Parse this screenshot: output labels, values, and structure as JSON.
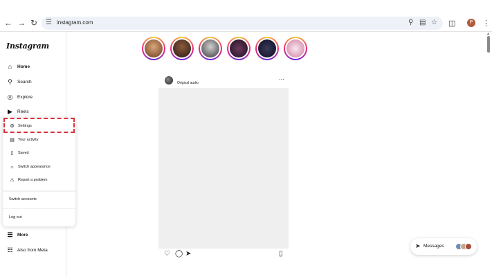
{
  "browser": {
    "url": "instagram.com",
    "profile_initial": "P"
  },
  "sidebar": {
    "logo": "Instagram",
    "nav": [
      {
        "label": "Home",
        "icon": "home-icon"
      },
      {
        "label": "Search",
        "icon": "search-icon"
      },
      {
        "label": "Explore",
        "icon": "compass-icon"
      },
      {
        "label": "Reels",
        "icon": "reels-icon"
      }
    ],
    "bottom": [
      {
        "label": "More",
        "icon": "menu-icon"
      },
      {
        "label": "Also from Meta",
        "icon": "meta-icon"
      }
    ]
  },
  "menu": {
    "items": [
      {
        "label": "Settings",
        "icon": "gear-icon"
      },
      {
        "label": "Your activity",
        "icon": "activity-icon"
      },
      {
        "label": "Saved",
        "icon": "bookmark-icon"
      },
      {
        "label": "Switch appearance",
        "icon": "sun-icon"
      },
      {
        "label": "Report a problem",
        "icon": "report-icon"
      }
    ],
    "switch_accounts": "Switch accounts",
    "logout": "Log out"
  },
  "post": {
    "audio_label": "Original audio"
  },
  "messages": {
    "label": "Messages"
  },
  "colors": {
    "highlight": "#d6333a",
    "story_ring": "#ee2a7b"
  }
}
